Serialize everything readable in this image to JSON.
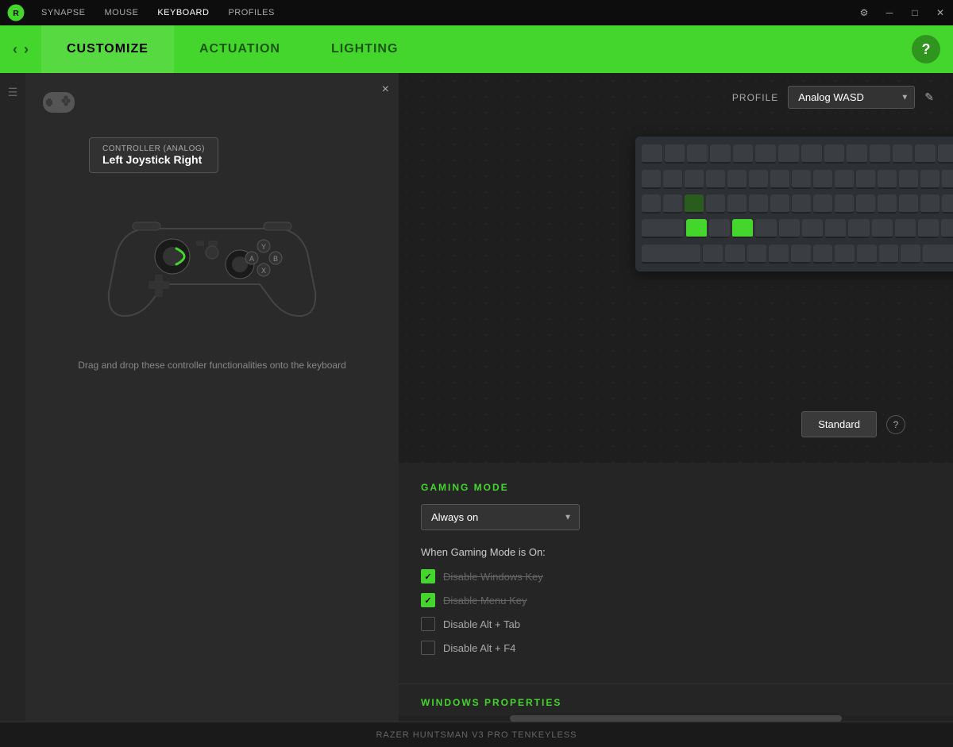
{
  "titleBar": {
    "nav": [
      "SYNAPSE",
      "MOUSE",
      "KEYBOARD",
      "PROFILES"
    ],
    "activeNav": "KEYBOARD"
  },
  "navBar": {
    "tabs": [
      "CUSTOMIZE",
      "ACTUATION",
      "LIGHTING"
    ],
    "activeTab": "CUSTOMIZE",
    "helpLabel": "?"
  },
  "leftPanel": {
    "controllerLabel": "CONTROLLER (ANALOG)",
    "joystickLabel": "Left Joystick Right",
    "dragHint": "Drag and drop these controller functionalities onto the keyboard",
    "closeIcon": "×"
  },
  "rightPanel": {
    "profileLabel": "PROFILE",
    "profileValue": "Analog WASD",
    "standardLabel": "Standard",
    "gamingMode": {
      "title": "GAMING MODE",
      "selectValue": "Always on",
      "whenLabel": "When Gaming Mode is On:",
      "checkboxes": [
        {
          "id": "win-key",
          "label": "Disable Windows Key",
          "checked": true,
          "strikethrough": true
        },
        {
          "id": "menu-key",
          "label": "Disable Menu Key",
          "checked": true,
          "strikethrough": true
        },
        {
          "id": "alt-tab",
          "label": "Disable Alt + Tab",
          "checked": false,
          "strikethrough": false
        },
        {
          "id": "alt-f4",
          "label": "Disable Alt + F4",
          "checked": false,
          "strikethrough": false
        }
      ]
    },
    "windowsProps": {
      "title": "WINDOWS PROPERTIES"
    }
  },
  "statusBar": {
    "deviceName": "RAZER HUNTSMAN V3 PRO TENKEYLESS"
  }
}
